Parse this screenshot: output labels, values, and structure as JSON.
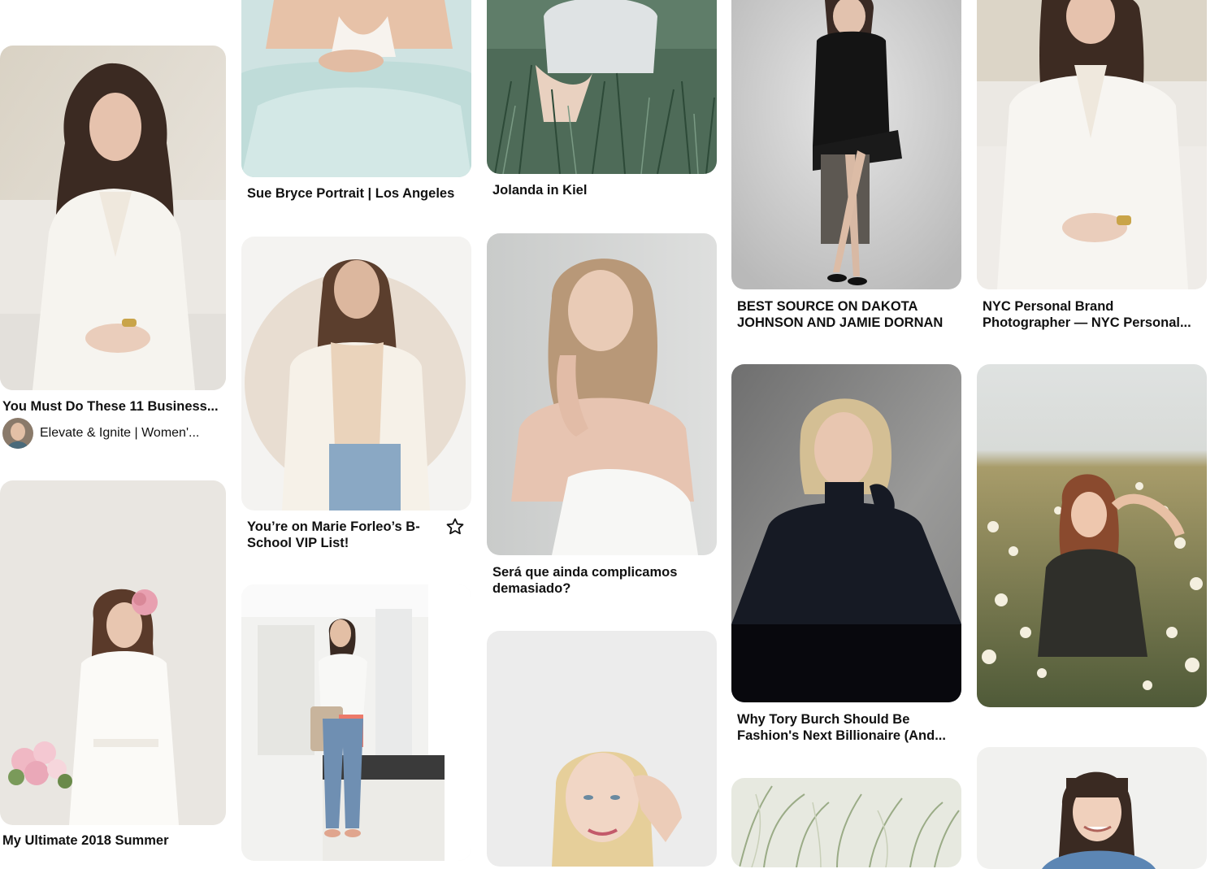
{
  "feed": {
    "pins": [
      {
        "title": "You Must Do These 11 Business...",
        "author": "Elevate & Ignite | Women'..."
      },
      {
        "title": "My Ultimate 2018 Summer"
      },
      {
        "title": "Sue Bryce Portrait | Los Angeles"
      },
      {
        "title": "You’re on Marie Forleo’s B-\nSchool VIP List!"
      },
      {
        "title": ""
      },
      {
        "title": "Jolanda in Kiel"
      },
      {
        "title": "Será que ainda complicamos\ndemasiado?"
      },
      {
        "title": ""
      },
      {
        "title": "BEST SOURCE ON DAKOTA\nJOHNSON AND JAMIE DORNAN"
      },
      {
        "title": "Why Tory Burch Should Be\nFashion's Next Billionaire (And..."
      },
      {
        "title": ""
      },
      {
        "title": "NYC Personal Brand\nPhotographer — NYC Personal..."
      },
      {
        "title": ""
      },
      {
        "title": ""
      }
    ]
  },
  "icons": {
    "save": "star-outline-icon"
  },
  "colors": {
    "text": "#111111",
    "background": "#ffffff"
  }
}
